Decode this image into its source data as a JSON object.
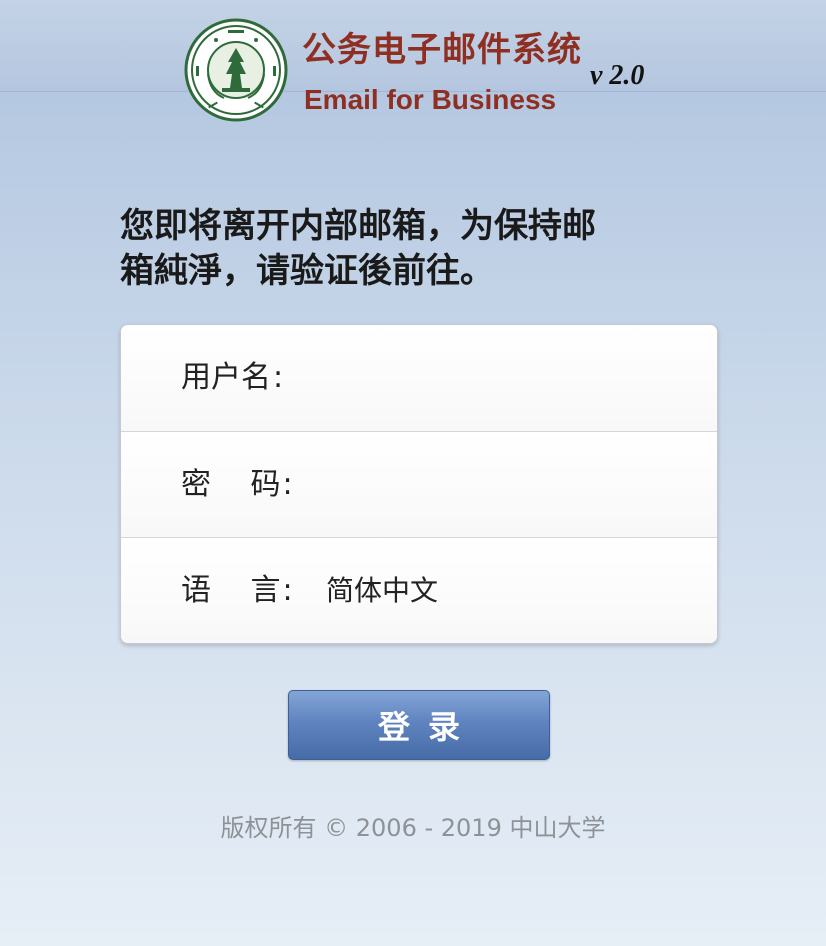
{
  "header": {
    "logo_alt": "Sun Yat-sen University seal",
    "brand_cn": "公务电子邮件系统",
    "brand_en": "Email for Business",
    "version": "v 2.0"
  },
  "notice": {
    "line1": "您即将离开内部邮箱，为保持邮",
    "line2": "箱純淨，请验证後前往。"
  },
  "form": {
    "username_label": "用户名",
    "password_label": "密　 码",
    "language_label": "语　 言",
    "colon": ":",
    "username_value": "",
    "password_value": "",
    "language_value": "简体中文"
  },
  "login_button": "登录",
  "copyright": "版权所有 © 2006 - 2019 中山大学",
  "colors": {
    "brand": "#8f2f22",
    "button": "#5f84c0",
    "background": "#c9d8ea"
  }
}
